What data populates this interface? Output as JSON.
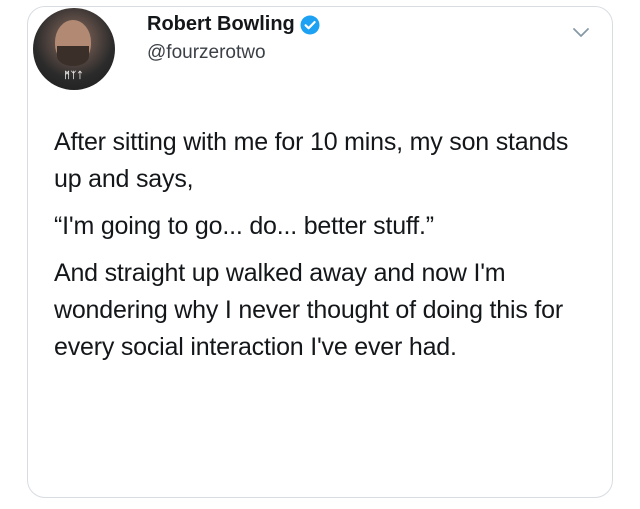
{
  "tweet": {
    "author": {
      "display_name": "Robert Bowling",
      "handle": "@fourzerotwo",
      "verified": true,
      "avatar_shirt_text": "ᛗᛉᛏ"
    },
    "paragraphs": [
      "After sitting with me for 10 mins, my son stands up and says,",
      "“I'm going to go... do... better stuff.”",
      "And straight up walked away and now I'm wondering why I never thought of doing this for every social interaction I've ever had."
    ]
  },
  "icons": {
    "verified": "verified-badge-icon",
    "menu": "chevron-down-icon"
  },
  "colors": {
    "verified_blue": "#1da1f2",
    "text": "#14171a",
    "border": "#d8dde2"
  }
}
